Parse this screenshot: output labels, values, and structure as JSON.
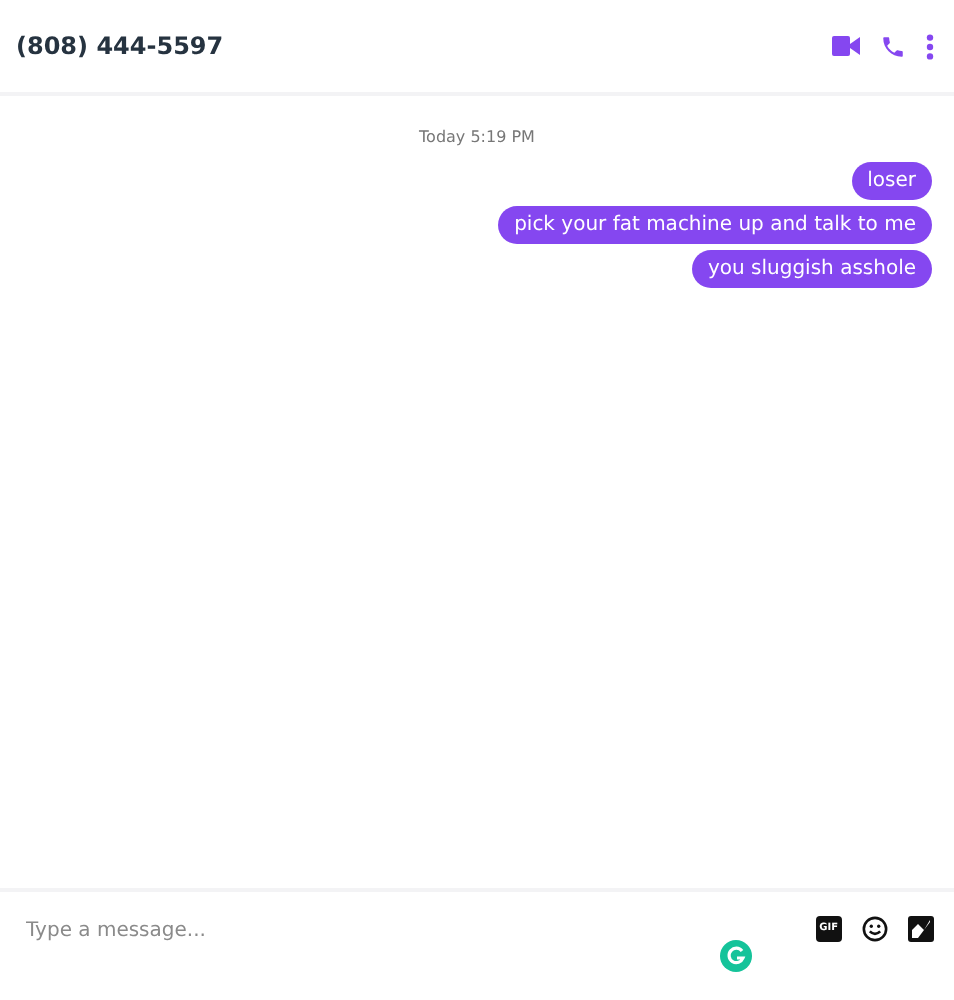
{
  "header": {
    "title": "(808) 444-5597"
  },
  "timestamp": "Today 5:19 PM",
  "messages": [
    {
      "text": "loser"
    },
    {
      "text": "pick your fat machine up and talk to me"
    },
    {
      "text": "you sluggish asshole"
    }
  ],
  "composer": {
    "placeholder": "Type a message...",
    "gif_label": "GIF"
  }
}
